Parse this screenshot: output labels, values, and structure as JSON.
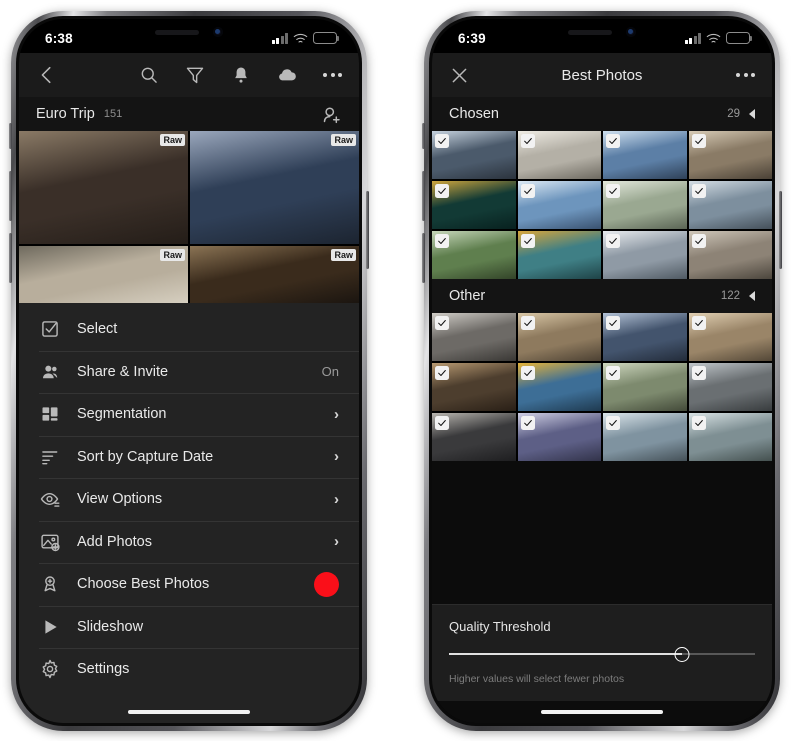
{
  "left_phone": {
    "status_bar": {
      "time": "6:38",
      "signal_icon": "cellular-bars-icon",
      "wifi_icon": "wifi-icon",
      "battery_icon": "battery-low-power-icon",
      "battery_color": "#f5d20a"
    },
    "toolbar": {
      "back_icon": "chevron-left-icon",
      "actions": [
        {
          "name": "search-icon",
          "label": "Search"
        },
        {
          "name": "filter-icon",
          "label": "Filter"
        },
        {
          "name": "bell-icon",
          "label": "Notifications"
        },
        {
          "name": "cloud-icon",
          "label": "Cloud Sync"
        },
        {
          "name": "more-icon",
          "label": "More"
        }
      ]
    },
    "album": {
      "title": "Euro Trip",
      "count": "151",
      "action_icon": "add-person-icon"
    },
    "photos": [
      {
        "raw_badge": "Raw",
        "c1": "#3a2f28",
        "c2": "#8a7a66",
        "c3": "#241d18"
      },
      {
        "raw_badge": "Raw",
        "c1": "#2f3f57",
        "c2": "#9aa7bc",
        "c3": "#1c2430"
      },
      {
        "raw_badge": "Raw",
        "c1": "#b8ae9c",
        "c2": "#6f6a5e",
        "c3": "#d6cfc0"
      },
      {
        "raw_badge": "Raw",
        "c1": "#3a2b1c",
        "c2": "#8a7354",
        "c3": "#1b1510"
      }
    ],
    "menu": [
      {
        "label": "Select",
        "icon": "checkbox-select-icon",
        "value": "",
        "chevron": false,
        "dot": false
      },
      {
        "label": "Share & Invite",
        "icon": "people-icon",
        "value": "On",
        "chevron": false,
        "dot": false
      },
      {
        "label": "Segmentation",
        "icon": "segmentation-icon",
        "value": "",
        "chevron": true,
        "dot": false
      },
      {
        "label": "Sort by Capture Date",
        "icon": "sort-icon",
        "value": "",
        "chevron": true,
        "dot": false
      },
      {
        "label": "View Options",
        "icon": "eye-options-icon",
        "value": "",
        "chevron": true,
        "dot": false
      },
      {
        "label": "Add Photos",
        "icon": "add-photos-icon",
        "value": "",
        "chevron": true,
        "dot": false
      },
      {
        "label": "Choose Best Photos",
        "icon": "award-icon",
        "value": "",
        "chevron": false,
        "dot": true
      },
      {
        "label": "Slideshow",
        "icon": "play-icon",
        "value": "",
        "chevron": false,
        "dot": false
      },
      {
        "label": "Settings",
        "icon": "gear-icon",
        "value": "",
        "chevron": false,
        "dot": false
      }
    ],
    "highlight_color": "#fa0f19"
  },
  "right_phone": {
    "status_bar": {
      "time": "6:39",
      "signal_icon": "cellular-bars-icon",
      "wifi_icon": "wifi-icon",
      "battery_icon": "battery-low-power-icon",
      "battery_color": "#f5d20a"
    },
    "navbar": {
      "close_icon": "close-icon",
      "title": "Best Photos",
      "more_icon": "more-icon"
    },
    "sections": [
      {
        "title": "Chosen",
        "count": "29",
        "collapse_icon": "triangle-left-icon",
        "rows": [
          [
            {
              "checked": true,
              "c1": "#4b5a6b",
              "c2": "#c6d2de",
              "c3": "#2b333d"
            },
            {
              "checked": true,
              "c1": "#b4b0a6",
              "c2": "#efece4",
              "c3": "#6e6a61"
            },
            {
              "checked": true,
              "c1": "#5c7fa6",
              "c2": "#cfe0ef",
              "c3": "#2f4158"
            },
            {
              "checked": true,
              "c1": "#8a7b66",
              "c2": "#d7cbb6",
              "c3": "#4a4136"
            }
          ],
          [
            {
              "checked": true,
              "c1": "#123a35",
              "c2": "#cfa63e",
              "c3": "#08211f"
            },
            {
              "checked": true,
              "c1": "#6d95bd",
              "c2": "#dce9f4",
              "c3": "#3a5270"
            },
            {
              "checked": true,
              "c1": "#9aa891",
              "c2": "#e3e8dc",
              "c3": "#5b6555"
            },
            {
              "checked": true,
              "c1": "#7d8f9e",
              "c2": "#d4dde4",
              "c3": "#45505a"
            }
          ],
          [
            {
              "checked": true,
              "c1": "#5f7f4e",
              "c2": "#c7d7bb",
              "c3": "#334429"
            },
            {
              "checked": true,
              "c1": "#3f7f85",
              "c2": "#d9a73c",
              "c3": "#1f4347"
            },
            {
              "checked": true,
              "c1": "#8f9aa5",
              "c2": "#e9ecef",
              "c3": "#505a63"
            },
            {
              "checked": true,
              "c1": "#8d8376",
              "c2": "#cfc7ba",
              "c3": "#4c463d"
            }
          ]
        ]
      },
      {
        "title": "Other",
        "count": "122",
        "collapse_icon": "triangle-left-icon",
        "rows": [
          [
            {
              "checked": true,
              "c1": "#6d6a66",
              "c2": "#d0cdc7",
              "c3": "#3a3835"
            },
            {
              "checked": true,
              "c1": "#8e7a5e",
              "c2": "#d9c7a6",
              "c3": "#4c4133"
            },
            {
              "checked": true,
              "c1": "#43546d",
              "c2": "#b3c2d6",
              "c3": "#232c3a"
            },
            {
              "checked": true,
              "c1": "#9a8568",
              "c2": "#e0cfb2",
              "c3": "#534737"
            }
          ],
          [
            {
              "checked": true,
              "c1": "#4d3e2e",
              "c2": "#b89a72",
              "c3": "#291f16"
            },
            {
              "checked": true,
              "c1": "#3d6e96",
              "c2": "#e6b43a",
              "c3": "#1f3a50"
            },
            {
              "checked": true,
              "c1": "#7d8a6e",
              "c2": "#cfd8c0",
              "c3": "#434a39"
            },
            {
              "checked": true,
              "c1": "#6a6f72",
              "c2": "#c0c6ca",
              "c3": "#383c3e"
            }
          ],
          [
            {
              "checked": true,
              "c1": "#3a3a3c",
              "c2": "#b9b6b0",
              "c3": "#1e1e20"
            },
            {
              "checked": true,
              "c1": "#5d5f86",
              "c2": "#cfcfe4",
              "c3": "#32334a"
            },
            {
              "checked": true,
              "c1": "#7f93a0",
              "c2": "#dbe5ea",
              "c3": "#455158"
            },
            {
              "checked": true,
              "c1": "#7e8f93",
              "c2": "#d8e2e4",
              "c3": "#44504f"
            }
          ]
        ]
      }
    ],
    "slider": {
      "title": "Quality Threshold",
      "hint": "Higher values will select fewer photos",
      "value_percent": 76
    }
  }
}
